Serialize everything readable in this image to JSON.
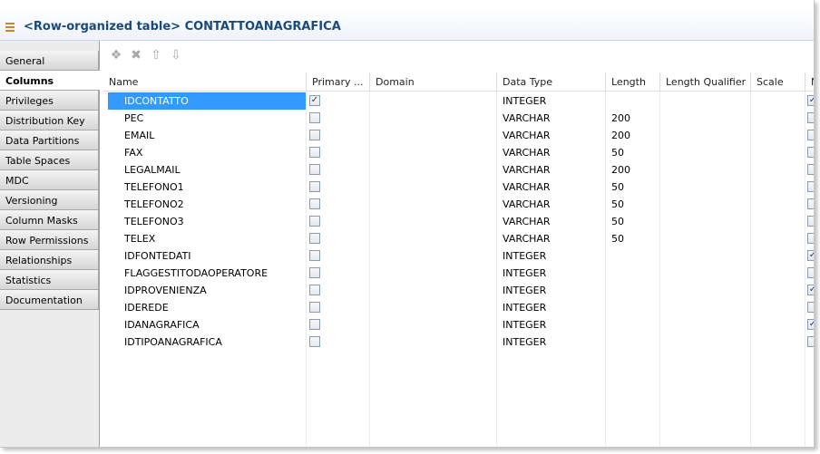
{
  "title": {
    "text": "<Row-organized table> CONTATTOANAGRAFICA"
  },
  "tabs": [
    {
      "label": "General",
      "active": false
    },
    {
      "label": "Columns",
      "active": true
    },
    {
      "label": "Privileges",
      "active": false
    },
    {
      "label": "Distribution Key",
      "active": false
    },
    {
      "label": "Data Partitions",
      "active": false
    },
    {
      "label": "Table Spaces",
      "active": false
    },
    {
      "label": "MDC",
      "active": false
    },
    {
      "label": "Versioning",
      "active": false
    },
    {
      "label": "Column Masks",
      "active": false
    },
    {
      "label": "Row Permissions",
      "active": false
    },
    {
      "label": "Relationships",
      "active": false
    },
    {
      "label": "Statistics",
      "active": false
    },
    {
      "label": "Documentation",
      "active": false
    }
  ],
  "toolbar": {
    "icons": [
      "add-column-icon",
      "delete-icon",
      "move-up-icon",
      "move-down-icon"
    ]
  },
  "columns": [
    "Name",
    "Primary ...",
    "Domain",
    "Data Type",
    "Length",
    "Length Qualifier",
    "Scale",
    "N"
  ],
  "rows": [
    {
      "name": "IDCONTATTO",
      "primary": true,
      "domain": "",
      "type": "INTEGER",
      "length": "",
      "nn": true,
      "selected": true
    },
    {
      "name": "PEC",
      "primary": false,
      "domain": "",
      "type": "VARCHAR",
      "length": "200",
      "nn": false,
      "selected": false
    },
    {
      "name": "EMAIL",
      "primary": false,
      "domain": "",
      "type": "VARCHAR",
      "length": "200",
      "nn": false,
      "selected": false
    },
    {
      "name": "FAX",
      "primary": false,
      "domain": "",
      "type": "VARCHAR",
      "length": "50",
      "nn": false,
      "selected": false
    },
    {
      "name": "LEGALMAIL",
      "primary": false,
      "domain": "",
      "type": "VARCHAR",
      "length": "200",
      "nn": false,
      "selected": false
    },
    {
      "name": "TELEFONO1",
      "primary": false,
      "domain": "",
      "type": "VARCHAR",
      "length": "50",
      "nn": false,
      "selected": false
    },
    {
      "name": "TELEFONO2",
      "primary": false,
      "domain": "",
      "type": "VARCHAR",
      "length": "50",
      "nn": false,
      "selected": false
    },
    {
      "name": "TELEFONO3",
      "primary": false,
      "domain": "",
      "type": "VARCHAR",
      "length": "50",
      "nn": false,
      "selected": false
    },
    {
      "name": "TELEX",
      "primary": false,
      "domain": "",
      "type": "VARCHAR",
      "length": "50",
      "nn": false,
      "selected": false
    },
    {
      "name": "IDFONTEDATI",
      "primary": false,
      "domain": "",
      "type": "INTEGER",
      "length": "",
      "nn": true,
      "selected": false
    },
    {
      "name": "FLAGGESTITODAOPERATORE",
      "primary": false,
      "domain": "",
      "type": "INTEGER",
      "length": "",
      "nn": false,
      "selected": false
    },
    {
      "name": "IDPROVENIENZA",
      "primary": false,
      "domain": "",
      "type": "INTEGER",
      "length": "",
      "nn": true,
      "selected": false
    },
    {
      "name": "IDEREDE",
      "primary": false,
      "domain": "",
      "type": "INTEGER",
      "length": "",
      "nn": false,
      "selected": false
    },
    {
      "name": "IDANAGRAFICA",
      "primary": false,
      "domain": "",
      "type": "INTEGER",
      "length": "",
      "nn": true,
      "selected": false
    },
    {
      "name": "IDTIPOANAGRAFICA",
      "primary": false,
      "domain": "",
      "type": "INTEGER",
      "length": "",
      "nn": false,
      "selected": false
    }
  ],
  "colors": {
    "title": "#1a4a7a",
    "selection": "#3399ff"
  }
}
